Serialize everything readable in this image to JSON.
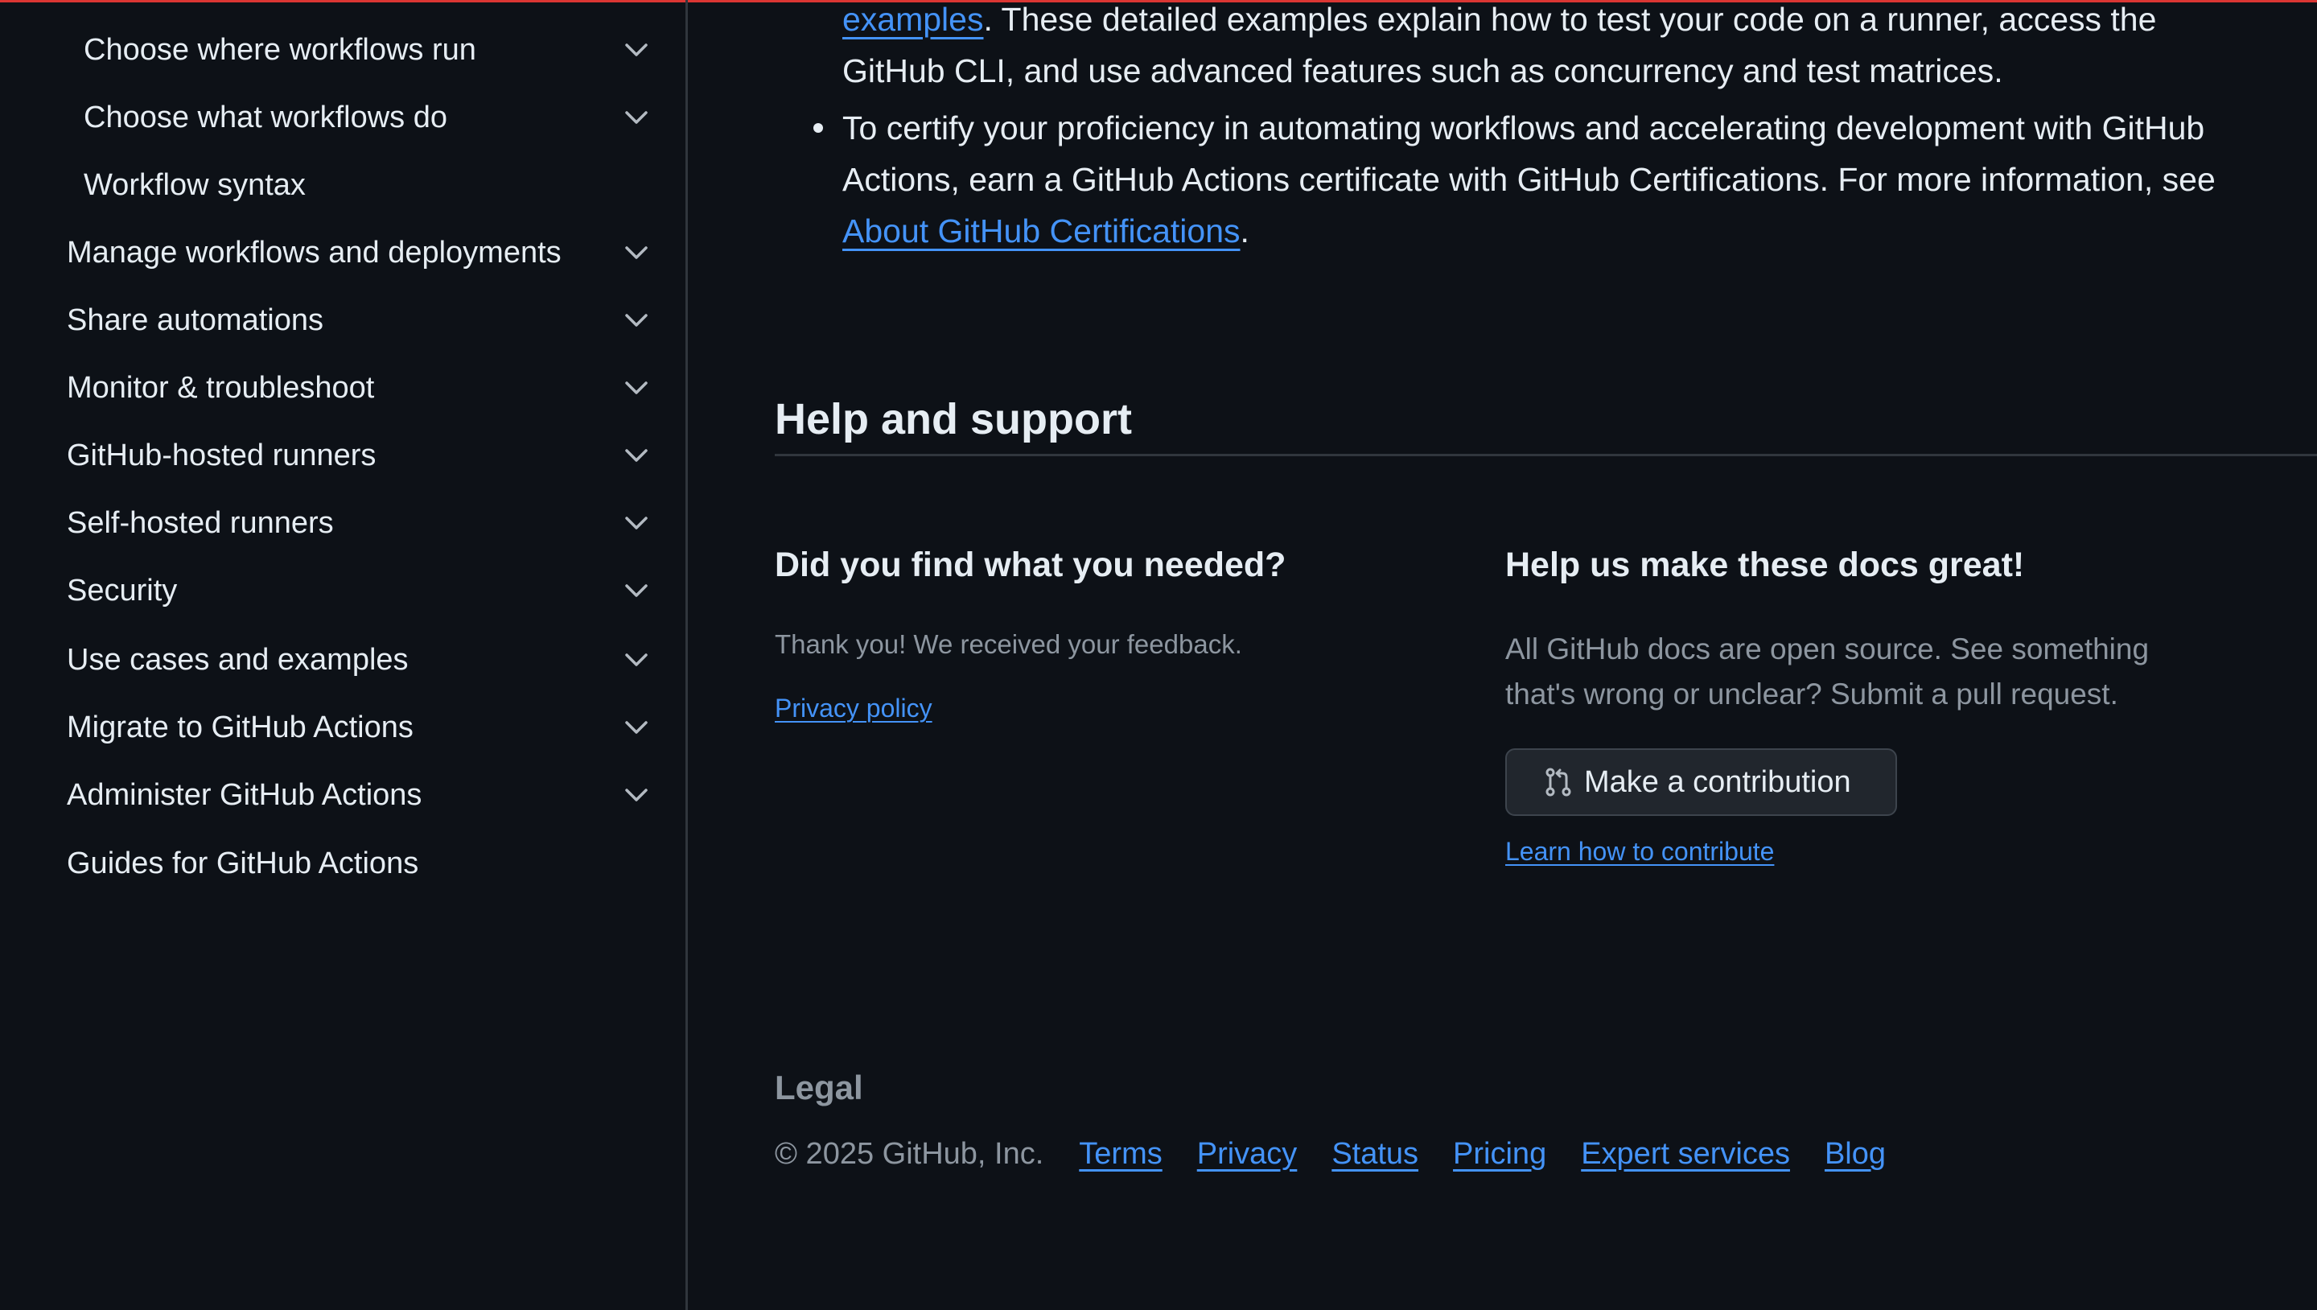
{
  "sidebar": {
    "items": [
      {
        "label": "Choose where workflows run",
        "level": "sub",
        "expandable": true
      },
      {
        "label": "Choose what workflows do",
        "level": "sub",
        "expandable": true
      },
      {
        "label": "Workflow syntax",
        "level": "sub",
        "expandable": false
      },
      {
        "label": "Manage workflows and deployments",
        "level": "top",
        "expandable": true
      },
      {
        "label": "Share automations",
        "level": "top",
        "expandable": true
      },
      {
        "label": "Monitor & troubleshoot",
        "level": "top",
        "expandable": true
      },
      {
        "label": "GitHub-hosted runners",
        "level": "top",
        "expandable": true
      },
      {
        "label": "Self-hosted runners",
        "level": "top",
        "expandable": true
      },
      {
        "label": "Security",
        "level": "top",
        "expandable": true
      },
      {
        "label": "Use cases and examples",
        "level": "top",
        "expandable": true
      },
      {
        "label": "Migrate to GitHub Actions",
        "level": "top",
        "expandable": true
      },
      {
        "label": "Administer GitHub Actions",
        "level": "top",
        "expandable": true
      },
      {
        "label": "Guides for GitHub Actions",
        "level": "top",
        "expandable": false
      }
    ]
  },
  "article": {
    "para1_link": "examples",
    "para1_rest_line1": ". These detailed examples explain how to test your code on a runner, access the",
    "para1_line2": "GitHub CLI, and use advanced features such as concurrency and test matrices.",
    "bullet2_line1": "To certify your proficiency in automating workflows and accelerating development with GitHub",
    "bullet2_line2": "Actions, earn a GitHub Actions certificate with GitHub Certifications. For more information, see",
    "bullet2_link": "About GitHub Certifications",
    "bullet2_end": "."
  },
  "support": {
    "heading": "Help and support",
    "feedback": {
      "heading": "Did you find what you needed?",
      "thanks": "Thank you! We received your feedback.",
      "privacy_link": "Privacy policy"
    },
    "contribute": {
      "heading": "Help us make these docs great!",
      "text_line1": "All GitHub docs are open source. See something",
      "text_line2": "that's wrong or unclear? Submit a pull request.",
      "button_label": "Make a contribution",
      "button_icon": "git-pull-request-icon",
      "learn_link": "Learn how to contribute"
    }
  },
  "footer": {
    "legal_title": "Legal",
    "copyright": "© 2025 GitHub, Inc.",
    "links": [
      "Terms",
      "Privacy",
      "Status",
      "Pricing",
      "Expert services",
      "Blog"
    ]
  },
  "colors": {
    "background": "#0d1117",
    "text": "#e6edf3",
    "muted": "#8d96a0",
    "link": "#4493f8",
    "border": "#30363d",
    "top_accent": "#da3633"
  }
}
